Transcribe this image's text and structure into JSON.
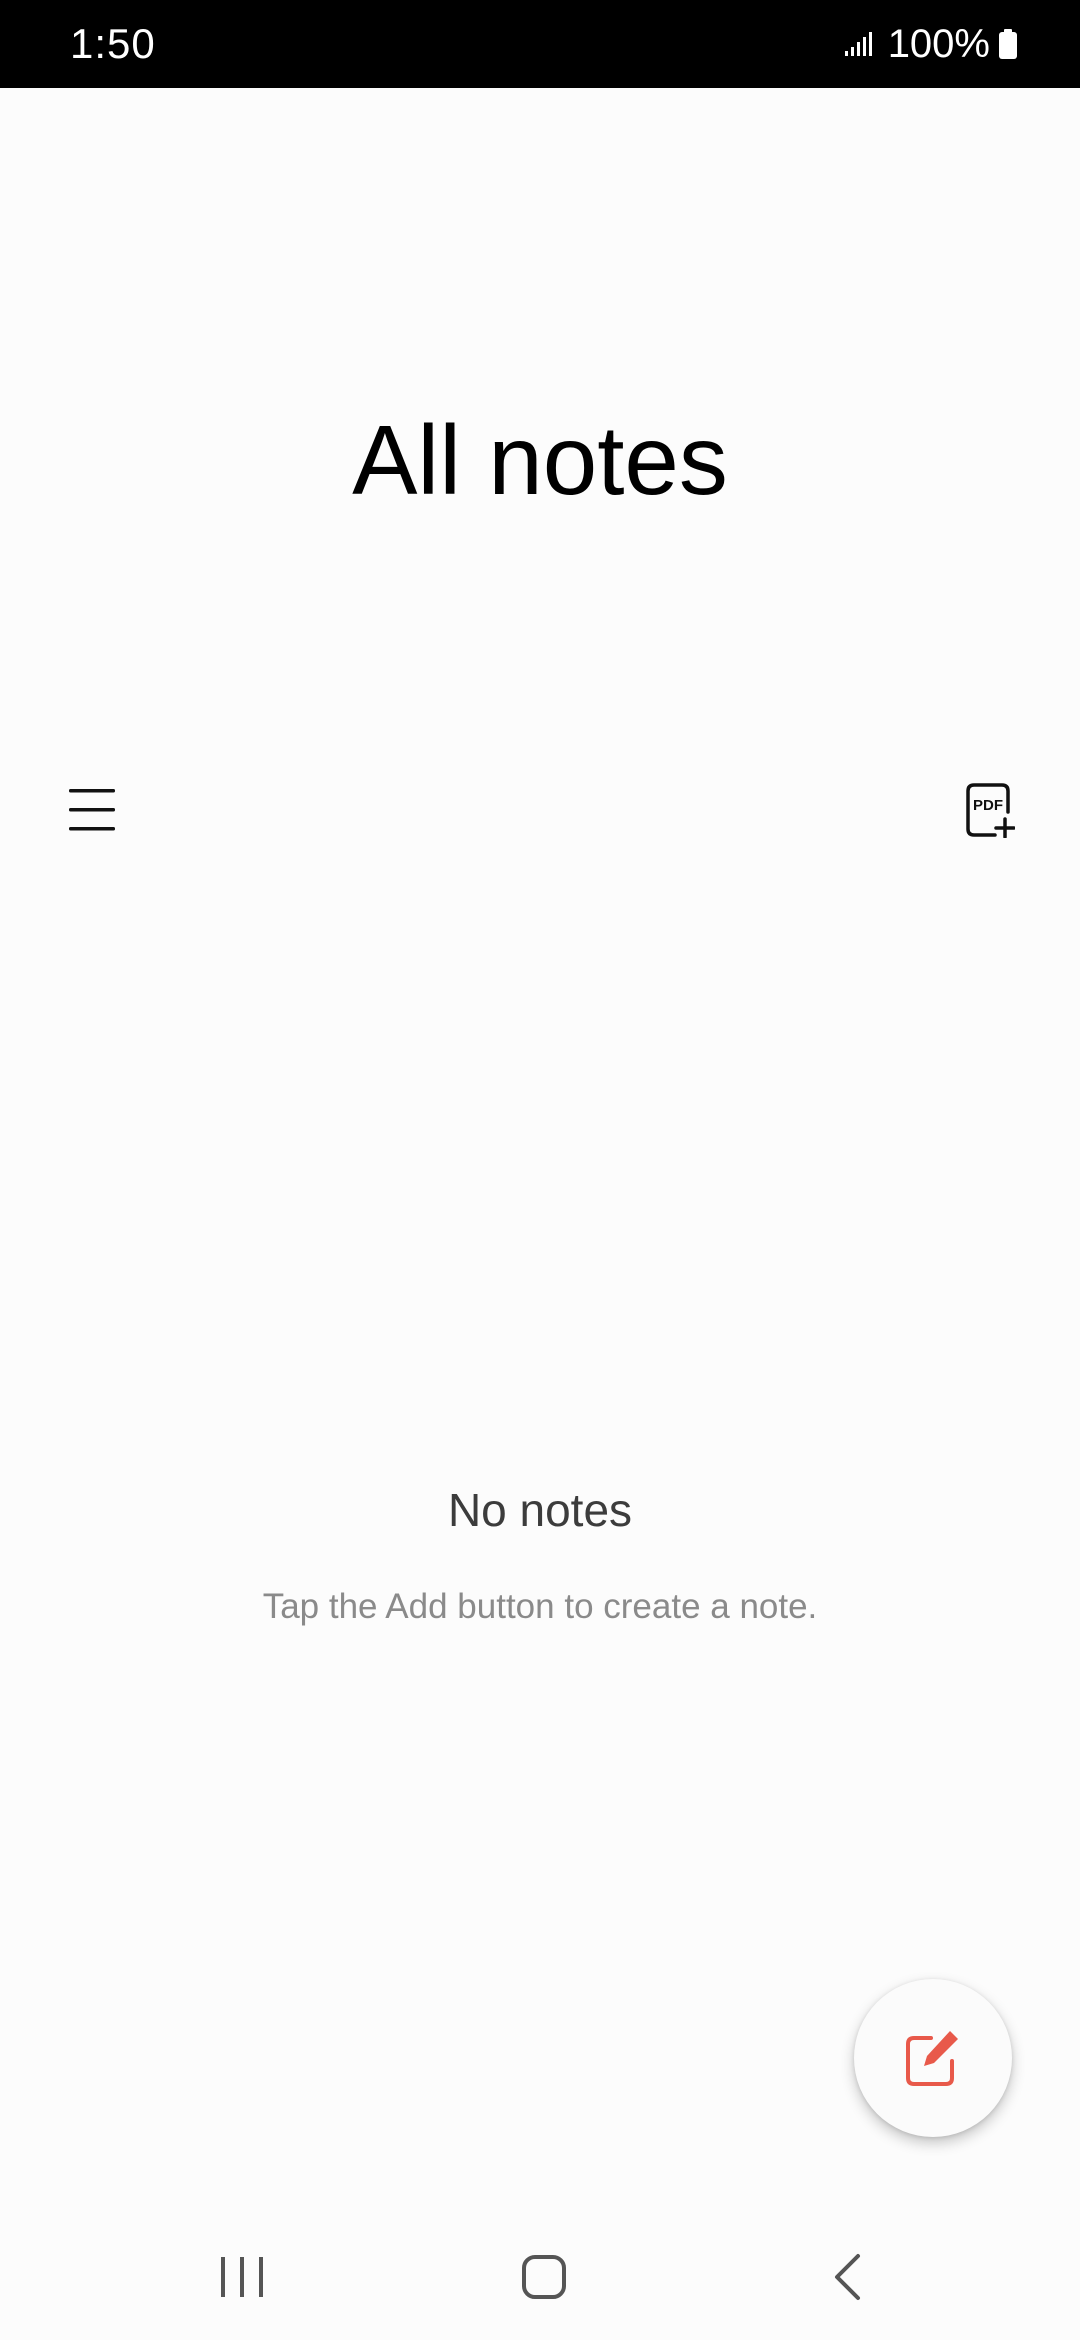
{
  "status_bar": {
    "time": "1:50",
    "battery": "100%",
    "icons": [
      "signal-icon",
      "battery-icon"
    ]
  },
  "header": {
    "title": "All notes"
  },
  "toolbar": {
    "menu_icon": "hamburger-menu-icon",
    "pdf_icon": "pdf-add-icon",
    "pdf_icon_text": "PDF"
  },
  "empty_state": {
    "title": "No notes",
    "subtitle": "Tap the Add button to create a note."
  },
  "fab": {
    "icon": "compose-note-icon",
    "accent_color": "#e8594a"
  },
  "nav_bar": {
    "items": [
      "recents-icon",
      "home-icon",
      "back-icon"
    ]
  }
}
